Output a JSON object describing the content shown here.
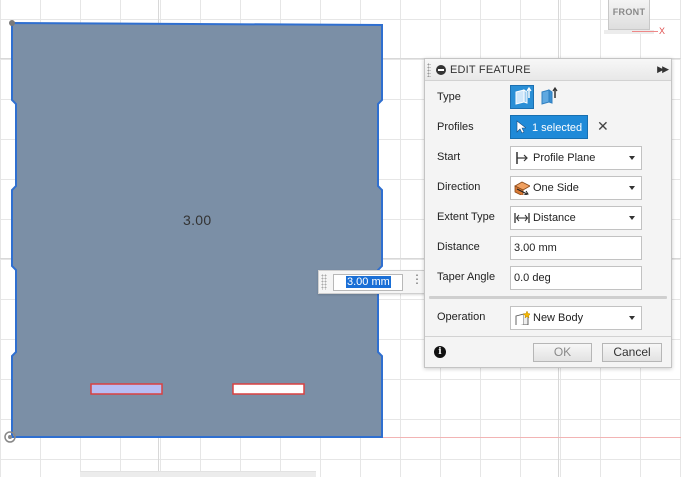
{
  "canvas": {
    "dimension_label": "3.00",
    "view_cube_label": "FRONT",
    "axis_x_label": "X"
  },
  "floating_input": {
    "value": "3.00 mm",
    "menu_glyph": "⋮"
  },
  "panel": {
    "title": "EDIT FEATURE",
    "expand_glyph": "▶▶",
    "rows": {
      "type": {
        "label": "Type"
      },
      "profiles": {
        "label": "Profiles",
        "selected": "1 selected",
        "clear_glyph": "✕"
      },
      "start": {
        "label": "Start",
        "value": "Profile Plane",
        "icon": "profile-plane-icon"
      },
      "direction": {
        "label": "Direction",
        "value": "One Side",
        "icon": "one-side-icon"
      },
      "extent_type": {
        "label": "Extent Type",
        "value": "Distance",
        "icon": "distance-icon"
      },
      "distance": {
        "label": "Distance",
        "value": "3.00 mm"
      },
      "taper_angle": {
        "label": "Taper Angle",
        "value": "0.0 deg"
      },
      "operation": {
        "label": "Operation",
        "value": "New Body",
        "icon": "new-body-icon"
      }
    },
    "info_glyph": "i",
    "ok_label": "OK",
    "cancel_label": "Cancel"
  },
  "colors": {
    "profile_fill": "#7b8fa6",
    "profile_edge": "#2f6fd0",
    "accent": "#1f8ad8"
  }
}
